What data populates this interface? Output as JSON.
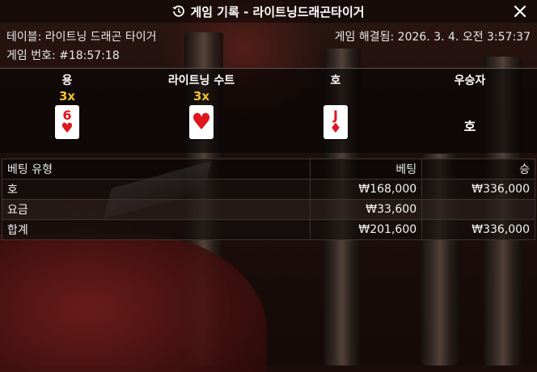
{
  "header": {
    "title": "게임 기록 - 라이트닝드래곤타이거"
  },
  "info": {
    "table": "테이블: 라이트닝 드래곤 타이거",
    "game_no": "게임 번호: #18:57:18",
    "resolved": "게임 해결됨: 2026. 3. 4. 오전 3:57:37"
  },
  "result": {
    "columns": [
      "용",
      "라이트닝 수트",
      "호",
      "우승자"
    ],
    "dragon": {
      "multiplier": "3x",
      "rank": "6",
      "suit": "♥",
      "suit_color": "#e0161d"
    },
    "lightning_suit": {
      "multiplier": "3x",
      "suit": "♥",
      "suit_color": "#e0161d"
    },
    "tiger": {
      "rank": "J",
      "suit": "♦",
      "suit_color": "#e0161d"
    },
    "winner": "호"
  },
  "bets": {
    "headers": {
      "type": "베팅 유형",
      "bet": "베팅",
      "win": "승"
    },
    "rows": [
      {
        "type": "호",
        "bet": "₩168,000",
        "win": "₩336,000"
      },
      {
        "type": "요금",
        "bet": "₩33,600",
        "win": ""
      },
      {
        "type": "합계",
        "bet": "₩201,600",
        "win": "₩336,000"
      }
    ]
  },
  "colors": {
    "multiplier": "#f2c230",
    "card_red": "#e0161d"
  }
}
